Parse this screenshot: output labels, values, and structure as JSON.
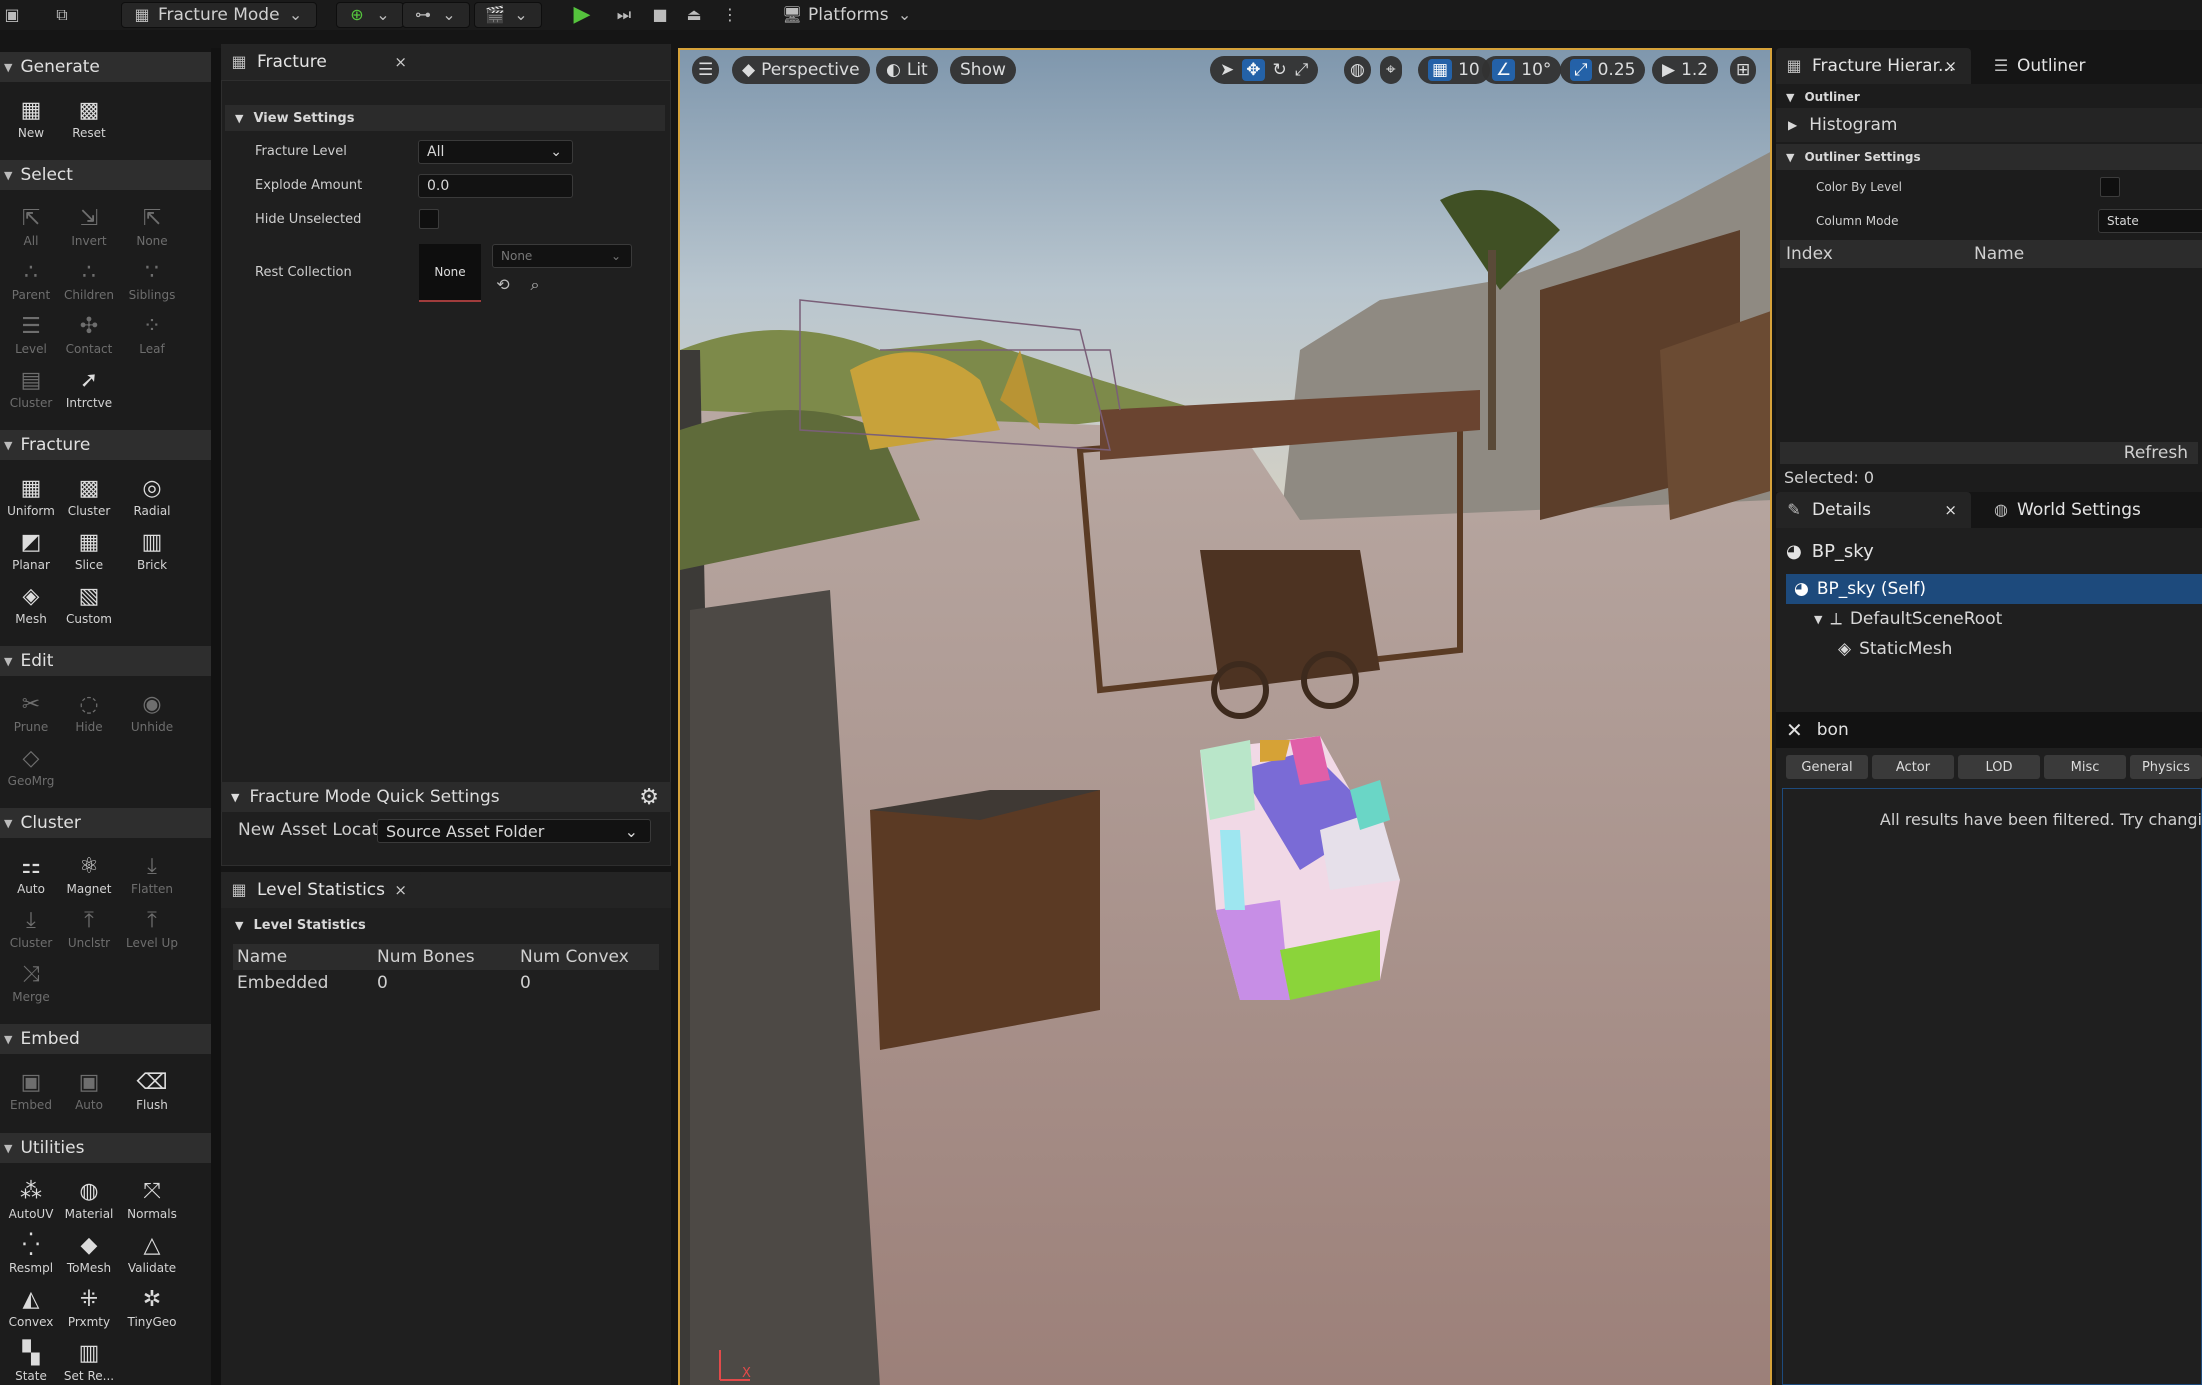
{
  "toolbar": {
    "mode_label": "Fracture Mode",
    "platforms_label": "Platforms",
    "accent_play": "#55c33d"
  },
  "palette": {
    "sections": {
      "generate": "Generate",
      "select": "Select",
      "fracture": "Fracture",
      "edit": "Edit",
      "cluster": "Cluster",
      "embed": "Embed",
      "utilities": "Utilities"
    },
    "generate_tools": [
      "New",
      "Reset"
    ],
    "select_tools": [
      "All",
      "Invert",
      "None",
      "Parent",
      "Children",
      "Siblings",
      "Level",
      "Contact",
      "Leaf",
      "Cluster",
      "Intrctve"
    ],
    "fracture_tools": [
      "Uniform",
      "Cluster",
      "Radial",
      "Planar",
      "Slice",
      "Brick",
      "Mesh",
      "Custom"
    ],
    "edit_tools": [
      "Prune",
      "Hide",
      "Unhide",
      "GeoMrg"
    ],
    "cluster_tools": [
      "Auto",
      "Magnet",
      "Flatten",
      "Cluster",
      "Unclstr",
      "Level Up",
      "Merge"
    ],
    "embed_tools": [
      "Embed",
      "Auto",
      "Flush"
    ],
    "utilities_tools": [
      "AutoUV",
      "Material",
      "Normals",
      "Resmpl",
      "ToMesh",
      "Validate",
      "Convex",
      "Prxmty",
      "TinyGeo",
      "State",
      "Set Re..."
    ]
  },
  "fracture_panel": {
    "tab_title": "Fracture",
    "close": "×",
    "view_settings": "View Settings",
    "fracture_level_label": "Fracture Level",
    "fracture_level_value": "All",
    "explode_amount_label": "Explode Amount",
    "explode_amount_value": "0.0",
    "hide_unselected_label": "Hide Unselected",
    "rest_collection_label": "Rest Collection",
    "rest_collection_thumb": "None",
    "rest_collection_value": "None",
    "quick_settings": "Fracture Mode Quick Settings",
    "new_asset_label": "New Asset Locatic",
    "new_asset_value": "Source Asset Folder"
  },
  "level_stats": {
    "tab_title": "Level Statistics",
    "close": "×",
    "section": "Level Statistics",
    "columns": [
      "Name",
      "Num Bones",
      "Num Convex"
    ],
    "rows": [
      [
        "Embedded",
        "0",
        "0"
      ]
    ]
  },
  "viewport": {
    "perspective": "Perspective",
    "lit": "Lit",
    "show": "Show",
    "grid_snap": "10",
    "rot_snap": "10°",
    "scale_snap": "0.25",
    "cam_speed": "1.2",
    "axis_x": "X"
  },
  "right_panel": {
    "hier_tab": "Fracture Hierar...",
    "outliner_tab": "Outliner",
    "close": "×",
    "outliner_section": "Outliner",
    "histogram": "Histogram",
    "outliner_settings": "Outliner Settings",
    "color_by_level": "Color By Level",
    "column_mode": "Column Mode",
    "column_mode_value": "State",
    "col_index": "Index",
    "col_name": "Name",
    "refresh": "Refresh",
    "selected": "Selected: 0",
    "details_tab": "Details",
    "world_settings_tab": "World Settings",
    "actor_name": "BP_sky",
    "tree": [
      "BP_sky (Self)",
      "DefaultSceneRoot",
      "StaticMesh"
    ],
    "search_value": "bon",
    "filter_tabs": [
      "General",
      "Actor",
      "LOD",
      "Misc",
      "Physics"
    ],
    "filtered_msg": "All results have been filtered. Try changi"
  }
}
